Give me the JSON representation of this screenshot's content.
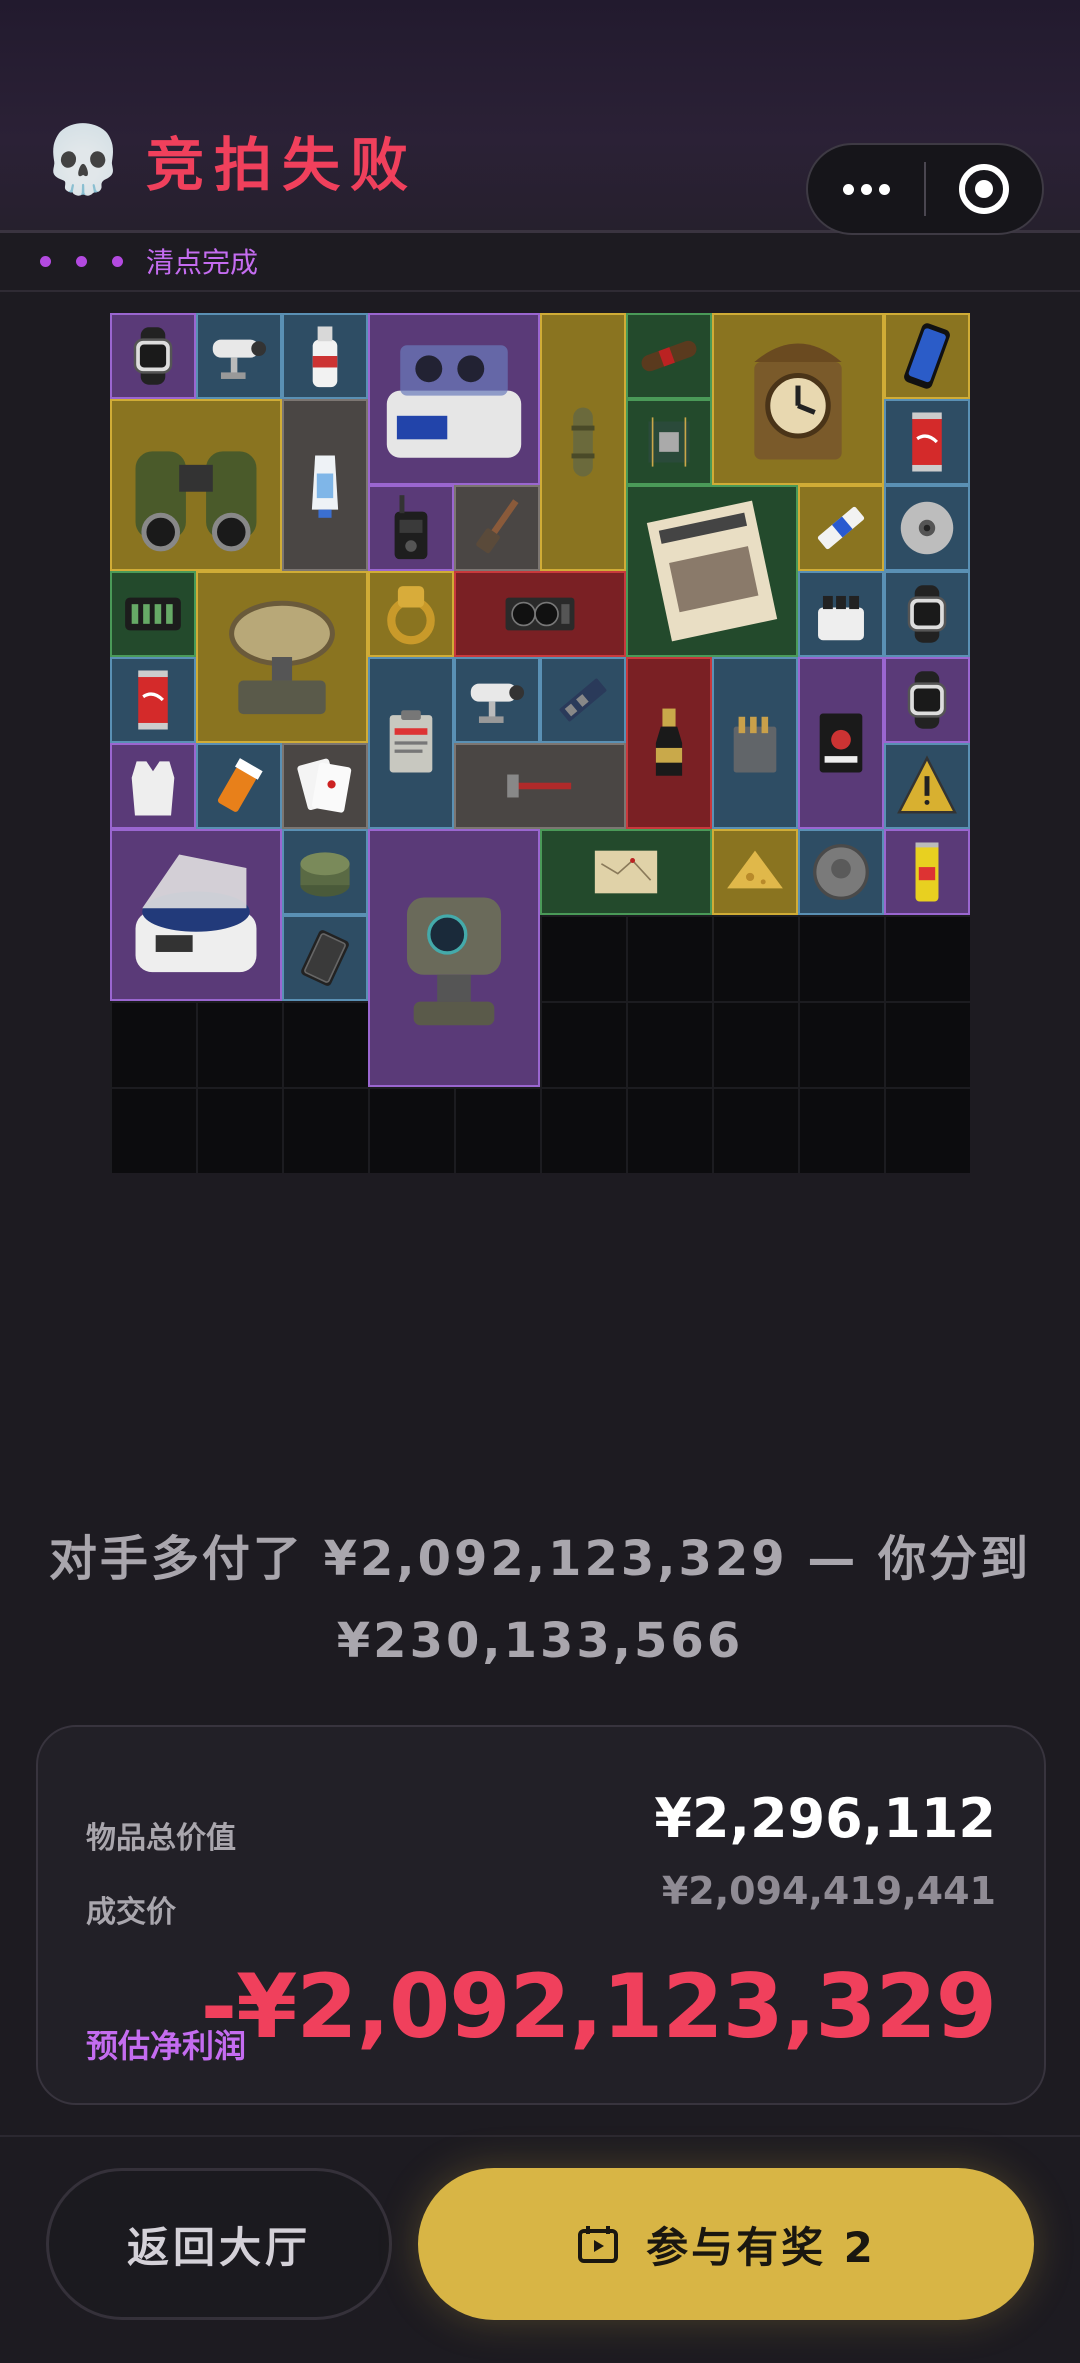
{
  "header": {
    "title": "竞拍失败",
    "skull_icon": "💀",
    "capsule": {
      "more_icon": "more-dots-icon",
      "close_icon": "target-icon"
    }
  },
  "status": {
    "text": "清点完成",
    "dot_color": "#b34ae0"
  },
  "inventory": {
    "rarity_colors": {
      "purple": "#9a66d0",
      "blue": "#5a90b4",
      "gold": "#d0ac36",
      "gray": "#7c7672",
      "green": "#4a9a58",
      "red": "#c8393c"
    },
    "items": [
      {
        "icon": "smartwatch-icon",
        "rarity": "purple"
      },
      {
        "icon": "security-camera-icon",
        "rarity": "blue"
      },
      {
        "icon": "bottle-icon",
        "rarity": "blue"
      },
      {
        "icon": "lab-shaker-icon",
        "rarity": "purple"
      },
      {
        "icon": "tube-case-icon",
        "rarity": "gold"
      },
      {
        "icon": "cigar-icon",
        "rarity": "green"
      },
      {
        "icon": "mantel-clock-icon",
        "rarity": "gold"
      },
      {
        "icon": "smartphone-icon",
        "rarity": "gold"
      },
      {
        "icon": "binoculars-icon",
        "rarity": "gold"
      },
      {
        "icon": "toothpaste-icon",
        "rarity": "gray"
      },
      {
        "icon": "circuit-chip-icon",
        "rarity": "green"
      },
      {
        "icon": "soda-can-icon",
        "rarity": "blue"
      },
      {
        "icon": "radio-icon",
        "rarity": "purple"
      },
      {
        "icon": "brush-icon",
        "rarity": "gray"
      },
      {
        "icon": "newspaper-icon",
        "rarity": "green"
      },
      {
        "icon": "ssd-icon",
        "rarity": "gold"
      },
      {
        "icon": "disc-icon",
        "rarity": "blue"
      },
      {
        "icon": "battery-pack-icon",
        "rarity": "green"
      },
      {
        "icon": "satellite-dish-icon",
        "rarity": "gold"
      },
      {
        "icon": "gold-ring-icon",
        "rarity": "gold"
      },
      {
        "icon": "graphics-card-icon",
        "rarity": "red"
      },
      {
        "icon": "fuel-cells-icon",
        "rarity": "blue"
      },
      {
        "icon": "smartwatch-icon",
        "rarity": "blue"
      },
      {
        "icon": "soda-can-icon",
        "rarity": "blue"
      },
      {
        "icon": "clipboard-icon",
        "rarity": "blue"
      },
      {
        "icon": "security-camera-icon",
        "rarity": "blue"
      },
      {
        "icon": "memory-stick-icon",
        "rarity": "blue"
      },
      {
        "icon": "champagne-icon",
        "rarity": "red"
      },
      {
        "icon": "ammo-box-icon",
        "rarity": "blue"
      },
      {
        "icon": "snack-pack-icon",
        "rarity": "purple"
      },
      {
        "icon": "smartwatch-icon",
        "rarity": "purple"
      },
      {
        "icon": "vest-icon",
        "rarity": "purple"
      },
      {
        "icon": "pill-bottle-icon",
        "rarity": "blue"
      },
      {
        "icon": "playing-cards-icon",
        "rarity": "gray"
      },
      {
        "icon": "hammer-icon",
        "rarity": "gray"
      },
      {
        "icon": "warning-sign-icon",
        "rarity": "blue"
      },
      {
        "icon": "centrifuge-icon",
        "rarity": "purple"
      },
      {
        "icon": "ration-can-icon",
        "rarity": "blue"
      },
      {
        "icon": "robot-turret-icon",
        "rarity": "purple"
      },
      {
        "icon": "map-icon",
        "rarity": "green"
      },
      {
        "icon": "cheese-icon",
        "rarity": "gold"
      },
      {
        "icon": "coin-icon",
        "rarity": "blue"
      },
      {
        "icon": "energy-drink-icon",
        "rarity": "purple"
      },
      {
        "icon": "hard-drive-icon",
        "rarity": "blue"
      }
    ]
  },
  "result": {
    "message": "对手多付了 ¥2,092,123,329 — 你分到 ¥230,133,566",
    "total_value_label": "物品总价值",
    "total_value": "¥2,296,112",
    "deal_price_label": "成交价",
    "deal_price": "¥2,094,419,441",
    "profit_label": "预估净利润",
    "profit": "-¥2,092,123,329",
    "profit_color": "#f0405c"
  },
  "actions": {
    "back_label": "返回大厅",
    "join_label": "参与有奖 2",
    "join_icon": "ticket-play-icon",
    "join_color": "#d8b545"
  }
}
